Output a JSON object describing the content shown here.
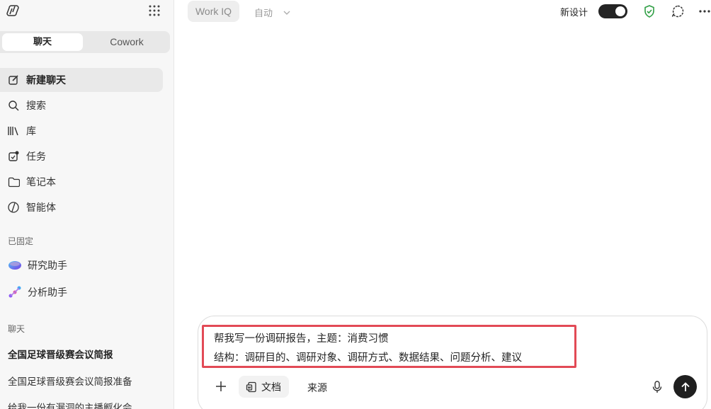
{
  "sidebar": {
    "tabs": {
      "chat": "聊天",
      "cowork": "Cowork"
    },
    "nav": [
      {
        "label": "新建聊天",
        "icon": "new-chat-icon"
      },
      {
        "label": "搜索",
        "icon": "search-icon"
      },
      {
        "label": "库",
        "icon": "library-icon"
      },
      {
        "label": "任务",
        "icon": "tasks-icon"
      },
      {
        "label": "笔记本",
        "icon": "folder-icon"
      },
      {
        "label": "智能体",
        "icon": "agent-icon"
      }
    ],
    "pinned_label": "已固定",
    "pinned": [
      {
        "label": "研究助手",
        "icon": "researcher-icon"
      },
      {
        "label": "分析助手",
        "icon": "analyst-icon"
      }
    ],
    "chats_label": "聊天",
    "chats": [
      "全国足球晋级赛会议简报",
      "全国足球晋级赛会议简报准备",
      "给我一份有漏洞的主播孵化会"
    ]
  },
  "topbar": {
    "workiq": "Work IQ",
    "mode": "自动",
    "new_design": "新设计",
    "toggle_on": true
  },
  "composer": {
    "line1": "帮我写一份调研报告，主题：消费习惯",
    "line2": "结构：调研目的、调研对象、调研方式、数据结果、问题分析、建议",
    "doc_label": "文档",
    "source_label": "来源"
  },
  "colors": {
    "highlight": "#e24a56",
    "shield": "#2f9e44",
    "send_bg": "#1f1f1f"
  }
}
